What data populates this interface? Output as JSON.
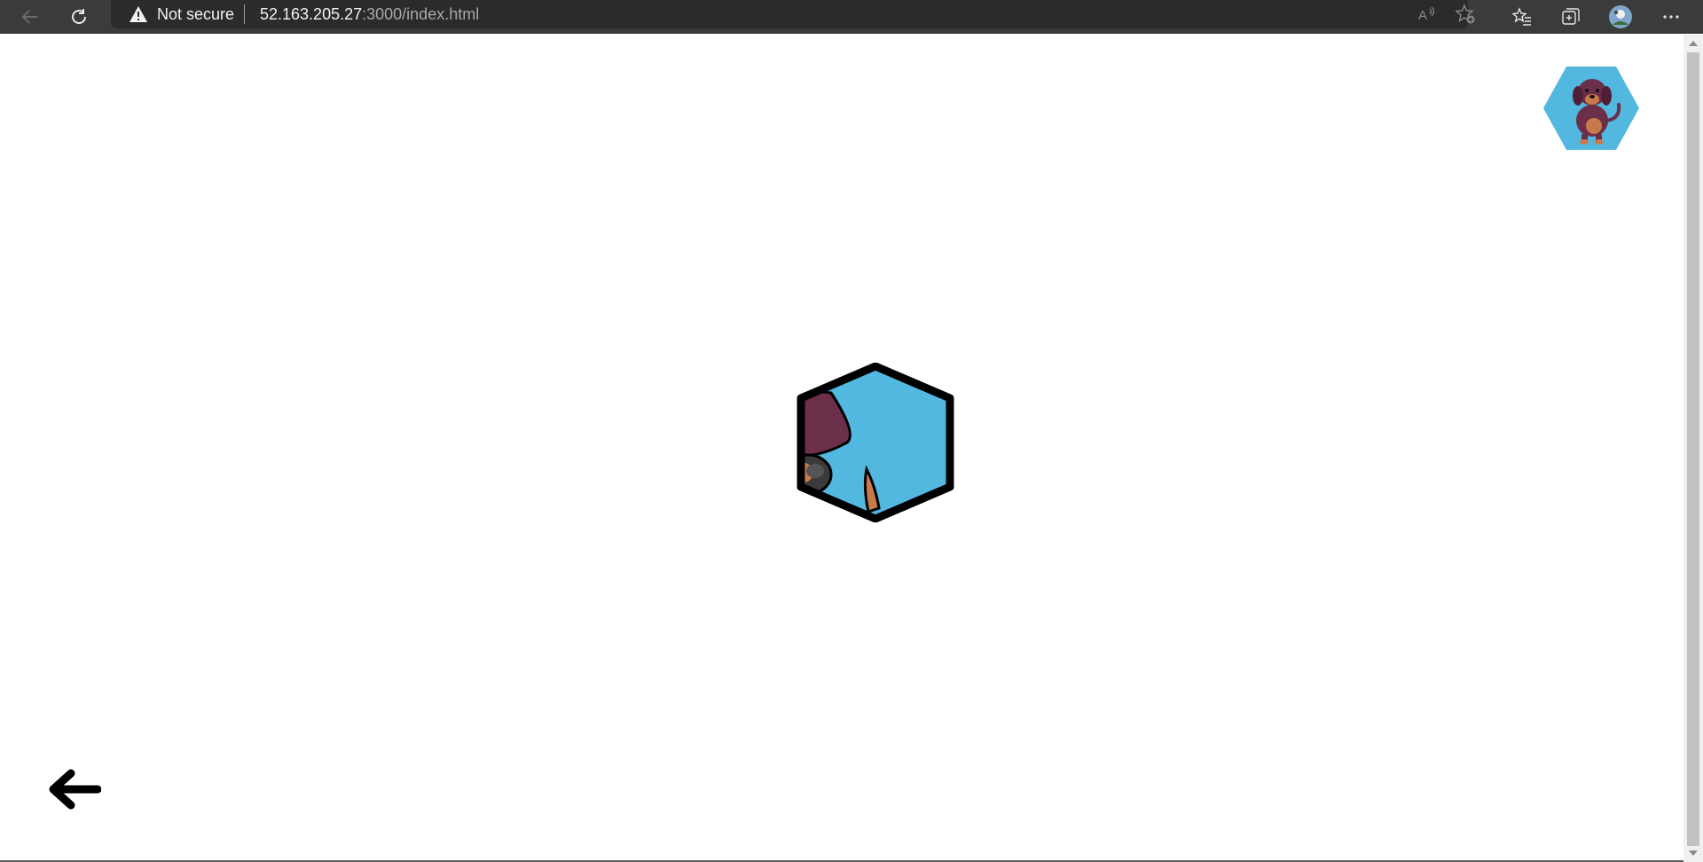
{
  "browser": {
    "security_label": "Not secure",
    "url_host": "52.163.205.27",
    "url_rest": ":3000/index.html",
    "icons": [
      "back-icon",
      "refresh-icon",
      "warning-icon",
      "read-aloud-icon",
      "add-favorite-icon",
      "favorites-icon",
      "collections-icon",
      "profile-icon",
      "more-icon"
    ]
  },
  "page": {
    "avatar_icon": "dachshund-avatar-icon",
    "puzzle_icon": "hexagon-puzzle-tile-icon",
    "back_icon": "left-arrow-icon",
    "colors": {
      "hex_fill": "#52b8e0",
      "dog": "#6b2f4a",
      "border": "#000000"
    }
  }
}
